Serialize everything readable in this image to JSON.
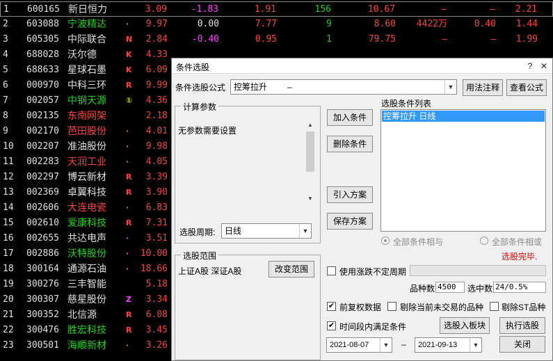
{
  "stocks": [
    {
      "idx": "1",
      "code": "600165",
      "name": "新日恒力",
      "flag": "",
      "price": "3.09",
      "chg": "-1.83",
      "amt": "1.91",
      "vol": "156",
      "v5": "10.67",
      "v6": "–",
      "v7": "–",
      "v8": "2.21"
    },
    {
      "idx": "2",
      "code": "603088",
      "name": "宁波精达",
      "flag": "·",
      "price": "9.97",
      "chg": "0.00",
      "amt": "7.77",
      "vol": "9",
      "v5": "8.60",
      "v6": "4422万",
      "v7": "0.40",
      "v8": "1.44"
    },
    {
      "idx": "3",
      "code": "605305",
      "name": "中际联合",
      "flag": "N",
      "price": "2.84",
      "chg": "-0.40",
      "amt": "0.95",
      "vol": "1",
      "v5": "79.75",
      "v6": "–",
      "v7": "–",
      "v8": "1.99"
    },
    {
      "idx": "4",
      "code": "688028",
      "name": "沃尔德",
      "flag": "K",
      "price": "4.33",
      "chg": "",
      "amt": "",
      "vol": "",
      "v5": "",
      "v6": "",
      "v7": "",
      "v8": ""
    },
    {
      "idx": "5",
      "code": "688633",
      "name": "星球石墨",
      "flag": "K",
      "price": "6.09",
      "chg": "",
      "amt": "",
      "vol": "",
      "v5": "",
      "v6": "",
      "v7": "",
      "v8": ""
    },
    {
      "idx": "6",
      "code": "000970",
      "name": "中科三环",
      "flag": "R",
      "price": "9.99",
      "chg": "",
      "amt": "",
      "vol": "",
      "v5": "",
      "v6": "",
      "v7": "",
      "v8": ""
    },
    {
      "idx": "7",
      "code": "002057",
      "name": "中钢天源",
      "flag": "①",
      "price": "4.36",
      "chg": "",
      "amt": "",
      "vol": "",
      "v5": "",
      "v6": "",
      "v7": "",
      "v8": ""
    },
    {
      "idx": "8",
      "code": "002135",
      "name": "东南网架",
      "flag": "",
      "price": "2.18",
      "chg": "",
      "amt": "",
      "vol": "",
      "v5": "",
      "v6": "",
      "v7": "",
      "v8": ""
    },
    {
      "idx": "9",
      "code": "002170",
      "name": "芭田股份",
      "flag": "·",
      "price": "4.01",
      "chg": "",
      "amt": "",
      "vol": "",
      "v5": "",
      "v6": "",
      "v7": "",
      "v8": ""
    },
    {
      "idx": "10",
      "code": "002207",
      "name": "准油股份",
      "flag": "·",
      "price": "9.98",
      "chg": "",
      "amt": "",
      "vol": "",
      "v5": "",
      "v6": "",
      "v7": "",
      "v8": ""
    },
    {
      "idx": "11",
      "code": "002283",
      "name": "天润工业",
      "flag": "·",
      "price": "4.05",
      "chg": "",
      "amt": "",
      "vol": "",
      "v5": "",
      "v6": "",
      "v7": "",
      "v8": ""
    },
    {
      "idx": "12",
      "code": "002297",
      "name": "博云新材",
      "flag": "R",
      "price": "3.39",
      "chg": "",
      "amt": "",
      "vol": "",
      "v5": "",
      "v6": "",
      "v7": "",
      "v8": ""
    },
    {
      "idx": "13",
      "code": "002369",
      "name": "卓翼科技",
      "flag": "R",
      "price": "3.90",
      "chg": "",
      "amt": "",
      "vol": "",
      "v5": "",
      "v6": "",
      "v7": "",
      "v8": ""
    },
    {
      "idx": "14",
      "code": "002606",
      "name": "大连电瓷",
      "flag": "·",
      "price": "6.83",
      "chg": "",
      "amt": "",
      "vol": "",
      "v5": "",
      "v6": "",
      "v7": "",
      "v8": ""
    },
    {
      "idx": "15",
      "code": "002610",
      "name": "爱康科技",
      "flag": "R",
      "price": "7.31",
      "chg": "",
      "amt": "",
      "vol": "",
      "v5": "",
      "v6": "",
      "v7": "",
      "v8": ""
    },
    {
      "idx": "16",
      "code": "002655",
      "name": "共达电声",
      "flag": "·",
      "price": "3.51",
      "chg": "",
      "amt": "",
      "vol": "",
      "v5": "",
      "v6": "",
      "v7": "",
      "v8": ""
    },
    {
      "idx": "17",
      "code": "002886",
      "name": "沃特股份",
      "flag": "·",
      "price": "10.00",
      "chg": "",
      "amt": "",
      "vol": "",
      "v5": "",
      "v6": "",
      "v7": "",
      "v8": ""
    },
    {
      "idx": "18",
      "code": "300164",
      "name": "通源石油",
      "flag": "·",
      "price": "18.66",
      "chg": "",
      "amt": "",
      "vol": "",
      "v5": "",
      "v6": "",
      "v7": "",
      "v8": ""
    },
    {
      "idx": "19",
      "code": "300276",
      "name": "三丰智能",
      "flag": "",
      "price": "5.18",
      "chg": "",
      "amt": "",
      "vol": "",
      "v5": "",
      "v6": "",
      "v7": "",
      "v8": ""
    },
    {
      "idx": "20",
      "code": "300307",
      "name": "慈星股份",
      "flag": "Z",
      "price": "3.34",
      "chg": "",
      "amt": "",
      "vol": "",
      "v5": "",
      "v6": "",
      "v7": "",
      "v8": ""
    },
    {
      "idx": "21",
      "code": "300352",
      "name": "北信源",
      "flag": "R",
      "price": "6.08",
      "chg": "",
      "amt": "",
      "vol": "",
      "v5": "",
      "v6": "",
      "v7": "",
      "v8": ""
    },
    {
      "idx": "22",
      "code": "300476",
      "name": "胜宏科技",
      "flag": "R",
      "price": "3.45",
      "chg": "",
      "amt": "",
      "vol": "",
      "v5": "",
      "v6": "",
      "v7": "",
      "v8": ""
    },
    {
      "idx": "23",
      "code": "300501",
      "name": "海顺新材",
      "flag": "·",
      "price": "3.26",
      "chg": "",
      "amt": "",
      "vol": "",
      "v5": "",
      "v6": "",
      "v7": "",
      "v8": ""
    }
  ],
  "colors": {
    "accent_select": "#3399ff",
    "red": "#ff4040",
    "green": "#20d020",
    "magenta": "#ff40ff"
  },
  "dialog": {
    "title": "条件选股",
    "formula_label": "条件选股公式",
    "formula_value": "控筹拉升",
    "formula_suffix": "–",
    "btn_usage": "用法注释",
    "btn_view_formula": "查看公式",
    "params_group_title": "计算参数",
    "params_text": "无参数需要设置",
    "period_label": "选股周期:",
    "period_value": "日线",
    "btn_add": "加入条件",
    "btn_delete": "删除条件",
    "btn_import": "引入方案",
    "btn_save": "保存方案",
    "list_title": "选股条件列表",
    "list_items": [
      "控筹拉升   日线"
    ],
    "radio_and": "全部条件相与",
    "radio_or": "全部条件相或",
    "status": "选股完毕.",
    "range_group_title": "选股范围",
    "range_text": "上证A股 深证A股",
    "btn_change_range": "改变范围",
    "chk_uncertain_period": "使用涨跌不定周期",
    "count_label": "品种数",
    "count_value": "4500",
    "selected_label": "选中数",
    "selected_value": "24/0.5%",
    "chk_adjust": "前复权数据",
    "chk_exclude_no_trade": "剔除当前未交易的品种",
    "chk_exclude_st": "剔除ST品种",
    "chk_time_range": "时间段内满足条件",
    "btn_to_block": "选股入板块",
    "btn_execute": "执行选股",
    "date_from": "2021-08-07",
    "date_sep": "–",
    "date_to": "2021-09-13",
    "btn_close": "关闭",
    "title_help": "?",
    "title_close": "✕"
  }
}
